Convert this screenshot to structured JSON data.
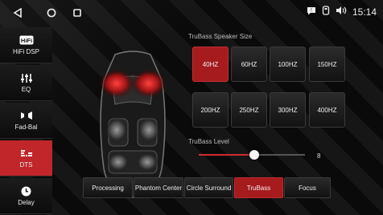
{
  "status": {
    "time": "15:14",
    "icons": [
      "notification-icon",
      "usb-icon",
      "volume-icon"
    ]
  },
  "nav": {
    "back_icon": "back-icon",
    "home_icon": "home-icon",
    "recents_icon": "recents-icon"
  },
  "sidebar": {
    "items": [
      {
        "label": "HiFi DSP",
        "icon": "hifi-icon",
        "active": false
      },
      {
        "label": "EQ",
        "icon": "eq-sliders-icon",
        "active": false
      },
      {
        "label": "Fad-Bal",
        "icon": "fader-balance-icon",
        "active": false
      },
      {
        "label": "DTS",
        "icon": "dts-icon",
        "active": true
      },
      {
        "label": "Delay",
        "icon": "clock-icon",
        "active": false
      }
    ]
  },
  "speaker_size": {
    "title": "TruBass Speaker Size",
    "options": [
      "40HZ",
      "60HZ",
      "100HZ",
      "150HZ",
      "200HZ",
      "250HZ",
      "300HZ",
      "400HZ"
    ],
    "selected": "40HZ"
  },
  "level": {
    "title": "TruBass Level",
    "value": "8",
    "fraction": 0.52
  },
  "tabs": {
    "items": [
      "Processing",
      "Phantom Center",
      "Circle Surround",
      "TruBass",
      "Focus"
    ],
    "selected": "TruBass"
  },
  "colors": {
    "accent": "#c0262a",
    "background": "#0b0b0b"
  }
}
